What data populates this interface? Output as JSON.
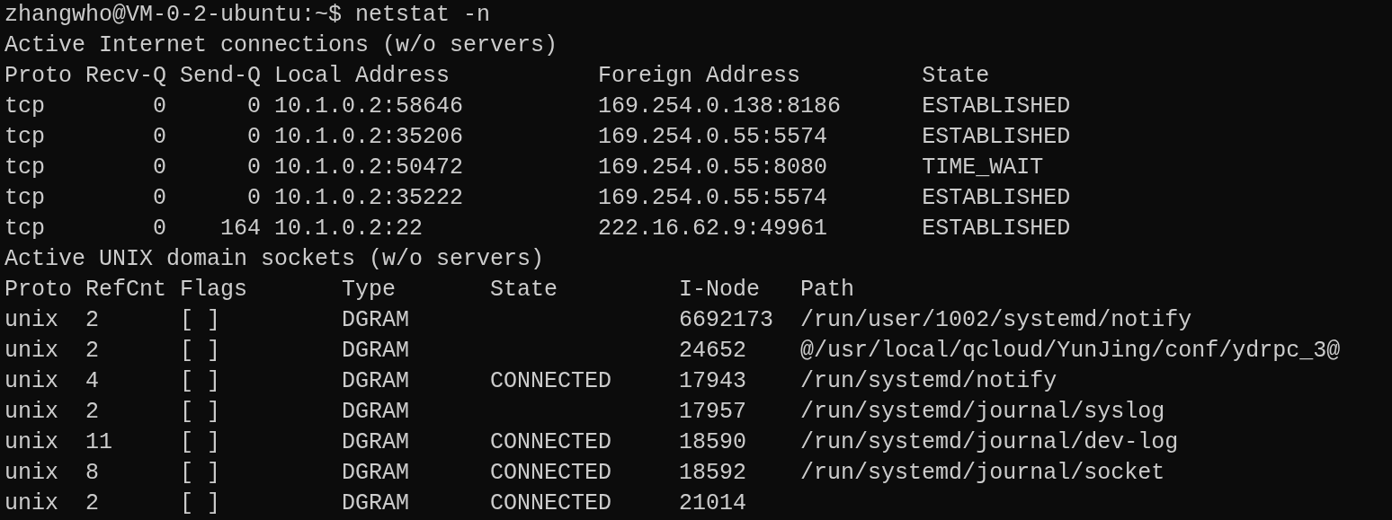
{
  "command_line": "zhangwho@VM-0-2-ubuntu:~$ netstat -n",
  "internet": {
    "title": "Active Internet connections (w/o servers)",
    "columns": [
      "Proto",
      "Recv-Q",
      "Send-Q",
      "Local Address",
      "Foreign Address",
      "State"
    ],
    "rows": [
      {
        "proto": "tcp",
        "recv_q": "0",
        "send_q": "0",
        "local": "10.1.0.2:58646",
        "foreign": "169.254.0.138:8186",
        "state": "ESTABLISHED"
      },
      {
        "proto": "tcp",
        "recv_q": "0",
        "send_q": "0",
        "local": "10.1.0.2:35206",
        "foreign": "169.254.0.55:5574",
        "state": "ESTABLISHED"
      },
      {
        "proto": "tcp",
        "recv_q": "0",
        "send_q": "0",
        "local": "10.1.0.2:50472",
        "foreign": "169.254.0.55:8080",
        "state": "TIME_WAIT"
      },
      {
        "proto": "tcp",
        "recv_q": "0",
        "send_q": "0",
        "local": "10.1.0.2:35222",
        "foreign": "169.254.0.55:5574",
        "state": "ESTABLISHED"
      },
      {
        "proto": "tcp",
        "recv_q": "0",
        "send_q": "164",
        "local": "10.1.0.2:22",
        "foreign": "222.16.62.9:49961",
        "state": "ESTABLISHED"
      }
    ]
  },
  "unix": {
    "title": "Active UNIX domain sockets (w/o servers)",
    "columns": [
      "Proto",
      "RefCnt",
      "Flags",
      "Type",
      "State",
      "I-Node",
      "Path"
    ],
    "rows": [
      {
        "proto": "unix",
        "refcnt": "2",
        "flags": "[ ]",
        "type": "DGRAM",
        "inode": "6692173",
        "path": "/run/user/1002/systemd/notify"
      },
      {
        "proto": "unix",
        "refcnt": "2",
        "flags": "[ ]",
        "type": "DGRAM",
        "inode": "24652",
        "path": "@/usr/local/qcloud/YunJing/conf/ydrpc_3@"
      },
      {
        "proto": "unix",
        "refcnt": "4",
        "flags": "[ ]",
        "type": "DGRAM",
        "state": "CONNECTED",
        "inode": "17943",
        "path": "/run/systemd/notify"
      },
      {
        "proto": "unix",
        "refcnt": "2",
        "flags": "[ ]",
        "type": "DGRAM",
        "inode": "17957",
        "path": "/run/systemd/journal/syslog"
      },
      {
        "proto": "unix",
        "refcnt": "11",
        "flags": "[ ]",
        "type": "DGRAM",
        "state": "CONNECTED",
        "inode": "18590",
        "path": "/run/systemd/journal/dev-log"
      },
      {
        "proto": "unix",
        "refcnt": "8",
        "flags": "[ ]",
        "type": "DGRAM",
        "state": "CONNECTED",
        "inode": "18592",
        "path": "/run/systemd/journal/socket"
      },
      {
        "proto": "unix",
        "refcnt": "2",
        "flags": "[ ]",
        "type": "DGRAM",
        "state": "CONNECTED",
        "inode": "21014"
      }
    ]
  }
}
